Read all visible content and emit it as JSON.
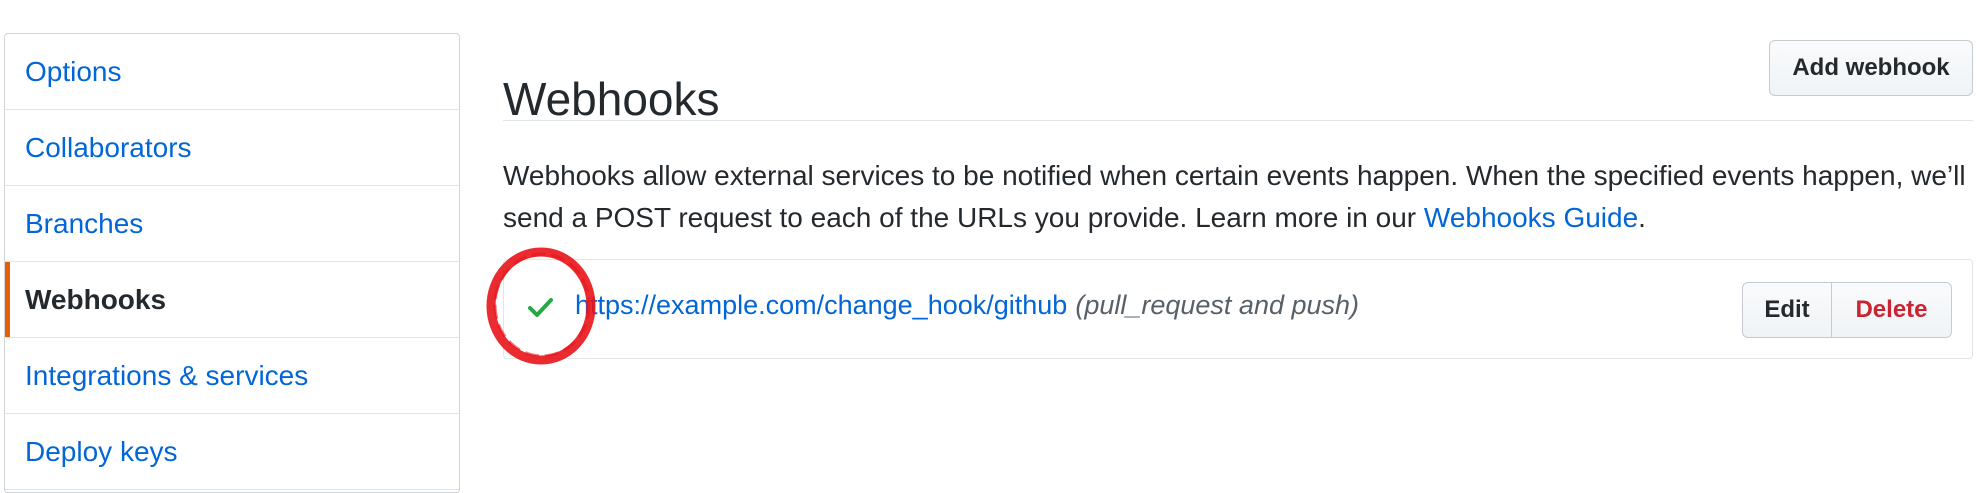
{
  "sidebar": {
    "items": [
      {
        "label": "Options"
      },
      {
        "label": "Collaborators"
      },
      {
        "label": "Branches"
      },
      {
        "label": "Webhooks"
      },
      {
        "label": "Integrations & services"
      },
      {
        "label": "Deploy keys"
      }
    ],
    "selected": "Webhooks"
  },
  "main": {
    "title": "Webhooks",
    "add_button": "Add webhook",
    "description_text": "Webhooks allow external services to be notified when certain events happen. When the specified events happen, we’ll send a POST request to each of the URLs you provide. Learn more in our ",
    "guide_link": "Webhooks Guide",
    "description_end": "."
  },
  "hook": {
    "status_icon": "check-icon",
    "url": "https://example.com/change_hook/github",
    "events": "(pull_request and push)",
    "edit_label": "Edit",
    "delete_label": "Delete"
  },
  "colors": {
    "link": "#0366d6",
    "selected_accent": "#e36209",
    "success": "#28a745",
    "danger": "#cb2431",
    "annotation": "#e8141a"
  }
}
